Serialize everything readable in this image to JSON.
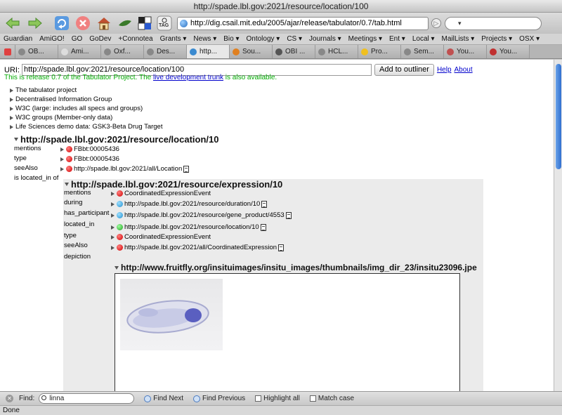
{
  "window": {
    "title": "http://spade.lbl.gov:2021/resource/location/100"
  },
  "toolbar": {
    "url": "http://dig.csail.mit.edu/2005/ajar/release/tabulator/0.7/tab.html",
    "tag_label": "TAG"
  },
  "bookmarks": [
    "Guardian",
    "AmiGO!",
    "GO",
    "GoDev",
    "+Connotea",
    "Grants ▾",
    "News ▾",
    "Bio ▾",
    "Ontology ▾",
    "CS ▾",
    "Journals ▾",
    "Meetings ▾",
    "Ent ▾",
    "Local ▾",
    "MailLists ▾",
    "Projects ▾",
    "OSX ▾"
  ],
  "tabs": [
    "OB...",
    "Ami...",
    "Oxf...",
    "Des...",
    "http...",
    "Sou...",
    "OBI ...",
    "HCL...",
    "Pro...",
    "Sem...",
    "You...",
    "You..."
  ],
  "page": {
    "uri_label": "URI:",
    "uri_value": "http://spade.lbl.gov:2021/resource/location/100",
    "outliner_button": "Add to outliner",
    "help": "Help",
    "about": "About",
    "release_prefix": "This is release 0.7 of the Tabulator Project. The ",
    "release_link": "live development trunk",
    "release_suffix": " is also available.",
    "projects": [
      "The tabulator project",
      "Decentralised Information Group",
      "W3C (large: includes all specs and groups)",
      "W3C groups (Member-only data)",
      "Life Sciences demo data: GSK3-Beta Drug Target"
    ],
    "outer": {
      "subject": "http://spade.lbl.gov:2021/resource/location/10",
      "predicates": [
        "mentions",
        "type",
        "seeAlso",
        "is located_in of"
      ],
      "objects": [
        "FBbt:00005436",
        "FBbt:00005436",
        "http://spade.lbl.gov:2021/all/Location"
      ]
    },
    "inner": {
      "subject": "http://spade.lbl.gov:2021/resource/expression/10",
      "predicates": [
        "mentions",
        "during",
        "has_participant",
        "located_in",
        "type",
        "seeAlso",
        "depiction"
      ],
      "objects": [
        "CoordinatedExpressionEvent",
        "http://spade.lbl.gov:2021/resource/duration/10",
        "http://spade.lbl.gov:2021/resource/gene_product/4553",
        "http://spade.lbl.gov:2021/resource/location/10",
        "CoordinatedExpressionEvent",
        "http://spade.lbl.gov:2021/all/CoordinatedExpression"
      ]
    },
    "depiction_subject": "http://www.fruitfly.org/insituimages/insitu_images/thumbnails/img_dir_23/insitu23096.jpe"
  },
  "findbar": {
    "label": "Find:",
    "query": "linna",
    "find_next": "Find Next",
    "find_previous": "Find Previous",
    "highlight_all": "Highlight all",
    "match_case": "Match case"
  },
  "status": "Done",
  "colors": {
    "accent_blue": "#2f6fd0",
    "release_green": "#00aa00",
    "link_blue": "#0000cc"
  }
}
